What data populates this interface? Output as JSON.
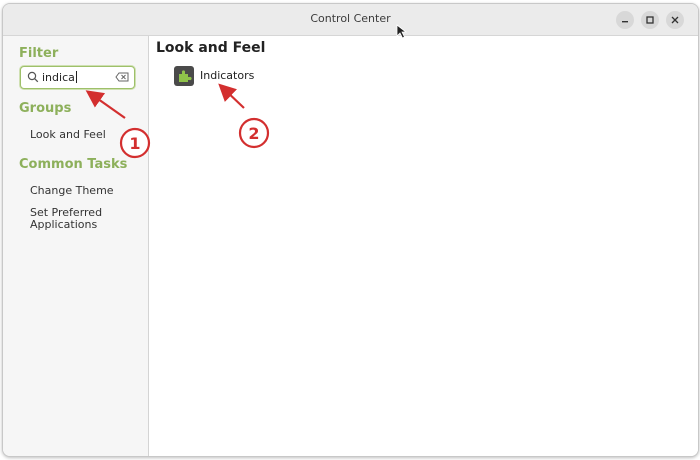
{
  "window": {
    "title": "Control Center"
  },
  "sidebar": {
    "filter_heading": "Filter",
    "search": {
      "value": "indica"
    },
    "groups_heading": "Groups",
    "groups": [
      "Look and Feel"
    ],
    "tasks_heading": "Common Tasks",
    "tasks": [
      "Change Theme",
      "Set Preferred Applications"
    ]
  },
  "main": {
    "section_title": "Look and Feel",
    "items": [
      {
        "label": "Indicators",
        "icon": "puzzle-piece-icon"
      }
    ]
  },
  "annotations": {
    "badges": [
      "1",
      "2"
    ],
    "color": "#d32f2f"
  },
  "colors": {
    "accent": "#8db05b",
    "annotation": "#d32f2f"
  }
}
